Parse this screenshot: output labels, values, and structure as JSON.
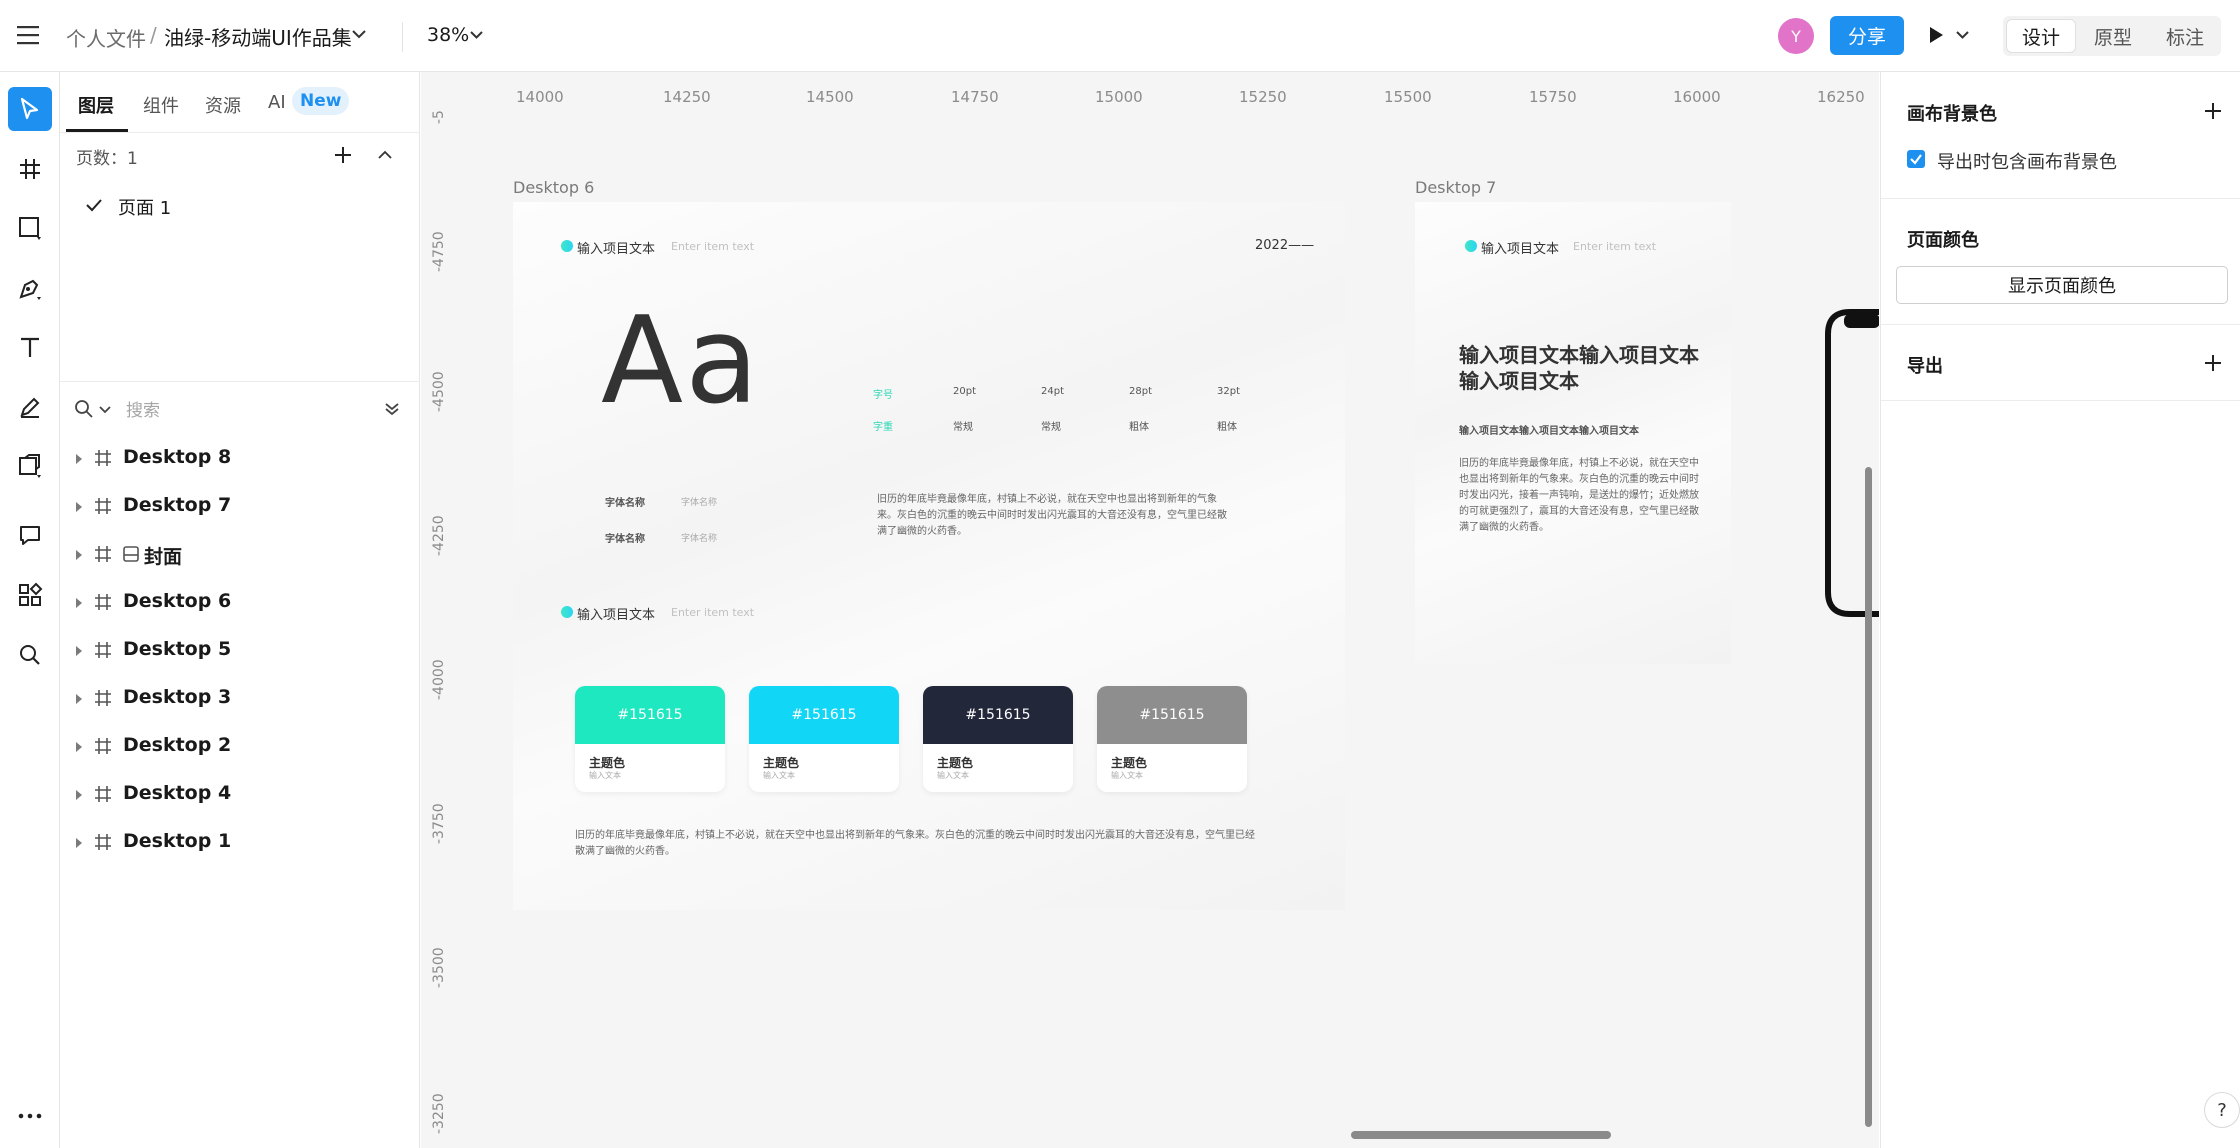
{
  "topbar": {
    "breadcrumb_parent": "个人文件",
    "breadcrumb_sep": "/",
    "file_title": "油绿-移动端UI作品集",
    "zoom": "38%",
    "avatar_letter": "Y",
    "share_label": "分享",
    "modes": [
      "设计",
      "原型",
      "标注"
    ]
  },
  "left_panel": {
    "tabs": [
      "图层",
      "组件",
      "资源",
      "AI"
    ],
    "new_badge": "New",
    "pages_count": "页数：1",
    "pages": [
      "页面 1"
    ],
    "search_placeholder": "搜索",
    "layers": [
      "Desktop 8",
      "Desktop 7",
      "封面",
      "Desktop 6",
      "Desktop 5",
      "Desktop 3",
      "Desktop 2",
      "Desktop 4",
      "Desktop 1"
    ]
  },
  "canvas": {
    "ruler_top": [
      "14000",
      "14250",
      "14500",
      "14750",
      "15000",
      "15250",
      "15500",
      "15750",
      "16000",
      "16250"
    ],
    "ruler_left": [
      "-5",
      "-4750",
      "-4500",
      "-4250",
      "-4000",
      "-3750",
      "-3500",
      "-3250"
    ],
    "frame6": {
      "title": "Desktop 6",
      "header_text": "输入项目文本",
      "header_sub": "Enter item text",
      "year": "2022——",
      "aa": "Aa",
      "font_name_label": "字体名称",
      "font_name_value": "字体名称",
      "spec_row1_label": "字号",
      "spec_row1": [
        "20pt",
        "24pt",
        "28pt",
        "32pt"
      ],
      "spec_row2_label": "字重",
      "spec_row2": [
        "常规",
        "常规",
        "粗体",
        "粗体"
      ],
      "para_right": "旧历的年底毕竟最像年底，村镇上不必说，就在天空中也显出将到新年的气象来。灰白色的沉重的晚云中间时时发出闪光震耳的大音还没有息，空气里已经散满了幽微的火药香。",
      "section2_text": "输入项目文本",
      "section2_sub": "Enter item text",
      "swatch_hex": "#151615",
      "swatch_name": "主题色",
      "swatch_sub": "输入文本",
      "swatch_colors": [
        "#1ee8c0",
        "#12d6f5",
        "#23273a",
        "#8e8e8e"
      ],
      "para_bottom": "旧历的年底毕竟最像年底，村镇上不必说，就在天空中也显出将到新年的气象来。灰白色的沉重的晚云中间时时发出闪光震耳的大音还没有息，空气里已经散满了幽微的火药香。"
    },
    "frame7": {
      "title": "Desktop 7",
      "header_text": "输入项目文本",
      "header_sub": "Enter item text",
      "headline": "输入项目文本输入项目文本输入项目文本",
      "subhead": "输入项目文本输入项目文本输入项目文本",
      "body": "旧历的年底毕竟最像年底，村镇上不必说，就在天空中也显出将到新年的气象来。灰白色的沉重的晚云中间时时发出闪光，接着一声钝响，是送灶的爆竹；近处燃放的可就更强烈了，震耳的大音还没有息，空气里已经散满了幽微的火药香。"
    }
  },
  "right_panel": {
    "canvas_bg_title": "画布背景色",
    "export_bg_label": "导出时包含画布背景色",
    "page_color_title": "页面颜色",
    "show_page_color_btn": "显示页面颜色",
    "export_title": "导出",
    "help": "?"
  },
  "colors": {
    "accent": "#1e90f0",
    "avatar": "#e173c8",
    "teal": "#2cd6b4"
  }
}
